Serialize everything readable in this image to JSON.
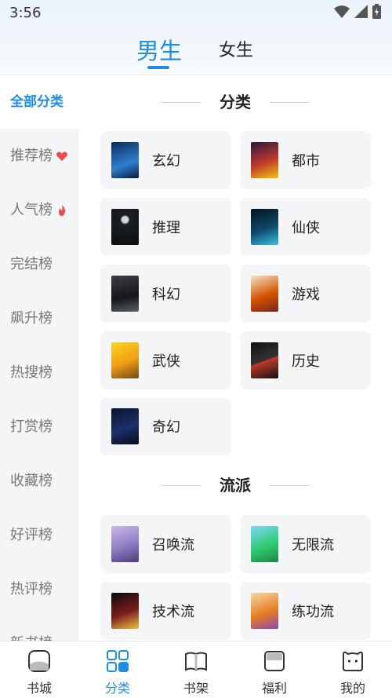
{
  "status_bar": {
    "time": "3:56"
  },
  "gender_tabs": {
    "male": "男生",
    "female": "女生",
    "active": "male"
  },
  "sidebar": {
    "all_label": "全部分类",
    "items": [
      {
        "label": "推荐榜",
        "badge": "heart-icon"
      },
      {
        "label": "人气榜",
        "badge": "flame-icon"
      },
      {
        "label": "完结榜"
      },
      {
        "label": "飙升榜"
      },
      {
        "label": "热搜榜"
      },
      {
        "label": "打赏榜"
      },
      {
        "label": "收藏榜"
      },
      {
        "label": "好评榜"
      },
      {
        "label": "热评榜"
      },
      {
        "label": "新书榜"
      }
    ]
  },
  "sections": [
    {
      "title": "分类",
      "items": [
        {
          "label": "玄幻"
        },
        {
          "label": "都市"
        },
        {
          "label": "推理"
        },
        {
          "label": "仙侠"
        },
        {
          "label": "科幻"
        },
        {
          "label": "游戏"
        },
        {
          "label": "武侠"
        },
        {
          "label": "历史"
        },
        {
          "label": "奇幻"
        }
      ]
    },
    {
      "title": "流派",
      "items": [
        {
          "label": "召唤流"
        },
        {
          "label": "无限流"
        },
        {
          "label": "技术流"
        },
        {
          "label": "练功流"
        }
      ]
    }
  ],
  "bottom_nav": [
    {
      "label": "书城",
      "icon": "bookstore-icon"
    },
    {
      "label": "分类",
      "icon": "category-icon",
      "active": true
    },
    {
      "label": "书架",
      "icon": "bookshelf-icon"
    },
    {
      "label": "福利",
      "icon": "welfare-icon"
    },
    {
      "label": "我的",
      "icon": "profile-icon"
    }
  ],
  "colors": {
    "accent": "#1f8ce6",
    "sidebar_bg": "#f4f5f7",
    "card_bg": "#f4f5f7",
    "badge_red": "#f04b4b"
  }
}
